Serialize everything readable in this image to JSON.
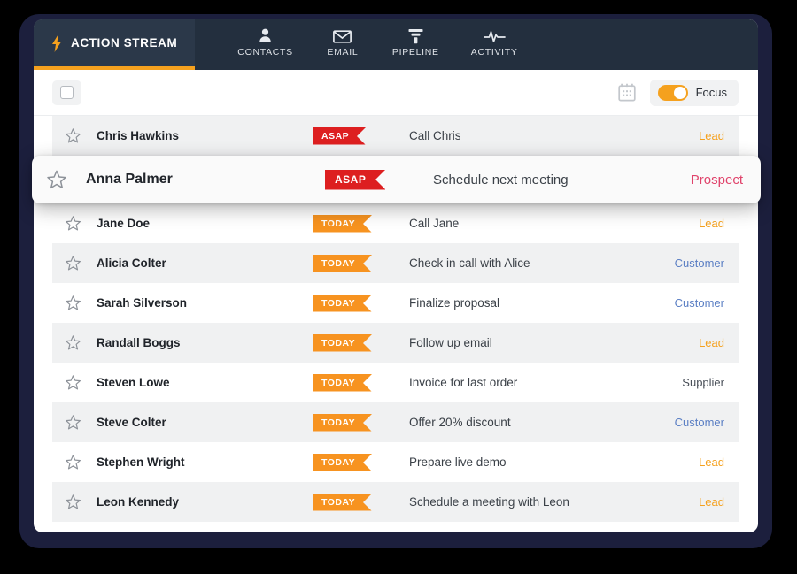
{
  "app": {
    "brand_label": "ACTION STREAM",
    "brand_icon": "lightning-bolt-icon",
    "accent_color": "#f5a11e",
    "header_bg": "#232f3e"
  },
  "nav": {
    "tabs": [
      {
        "label": "CONTACTS",
        "icon": "person-icon"
      },
      {
        "label": "EMAIL",
        "icon": "envelope-icon"
      },
      {
        "label": "PIPELINE",
        "icon": "funnel-icon"
      },
      {
        "label": "ACTIVITY",
        "icon": "heartbeat-icon"
      }
    ]
  },
  "toolbar": {
    "select_all_icon": "checkbox-icon",
    "calendar_icon": "calendar-icon",
    "focus_label": "Focus",
    "focus_enabled": true
  },
  "rows": [
    {
      "person": "Chris Hawkins",
      "badge": "ASAP",
      "badge_kind": "asap",
      "task": "Call Chris",
      "category": "Lead",
      "category_kind": "lead",
      "shade": "alt",
      "highlighted": false
    },
    {
      "person": "Anna Palmer",
      "badge": "ASAP",
      "badge_kind": "asap",
      "task": "Schedule next meeting",
      "category": "Prospect",
      "category_kind": "prospect",
      "shade": "plain",
      "highlighted": true
    },
    {
      "person": "Jane Doe",
      "badge": "TODAY",
      "badge_kind": "today",
      "task": "Call Jane",
      "category": "Lead",
      "category_kind": "lead",
      "shade": "plain",
      "highlighted": false
    },
    {
      "person": "Alicia Colter",
      "badge": "TODAY",
      "badge_kind": "today",
      "task": "Check in call with Alice",
      "category": "Customer",
      "category_kind": "customer",
      "shade": "alt",
      "highlighted": false
    },
    {
      "person": "Sarah Silverson",
      "badge": "TODAY",
      "badge_kind": "today",
      "task": "Finalize proposal",
      "category": "Customer",
      "category_kind": "customer",
      "shade": "plain",
      "highlighted": false
    },
    {
      "person": "Randall Boggs",
      "badge": "TODAY",
      "badge_kind": "today",
      "task": "Follow up email",
      "category": "Lead",
      "category_kind": "lead",
      "shade": "alt",
      "highlighted": false
    },
    {
      "person": "Steven Lowe",
      "badge": "TODAY",
      "badge_kind": "today",
      "task": "Invoice for last order",
      "category": "Supplier",
      "category_kind": "supplier",
      "shade": "plain",
      "highlighted": false
    },
    {
      "person": "Steve Colter",
      "badge": "TODAY",
      "badge_kind": "today",
      "task": "Offer 20% discount",
      "category": "Customer",
      "category_kind": "customer",
      "shade": "alt",
      "highlighted": false
    },
    {
      "person": "Stephen Wright",
      "badge": "TODAY",
      "badge_kind": "today",
      "task": "Prepare live demo",
      "category": "Lead",
      "category_kind": "lead",
      "shade": "plain",
      "highlighted": false
    },
    {
      "person": "Leon Kennedy",
      "badge": "TODAY",
      "badge_kind": "today",
      "task": "Schedule a meeting with Leon",
      "category": "Lead",
      "category_kind": "lead",
      "shade": "alt",
      "highlighted": false
    }
  ],
  "colors": {
    "asap_badge": "#dd1f20",
    "today_badge": "#f79320",
    "lead": "#f5a11e",
    "customer": "#5b7fc4",
    "supplier": "#4a5059",
    "prospect": "#e0436b"
  }
}
